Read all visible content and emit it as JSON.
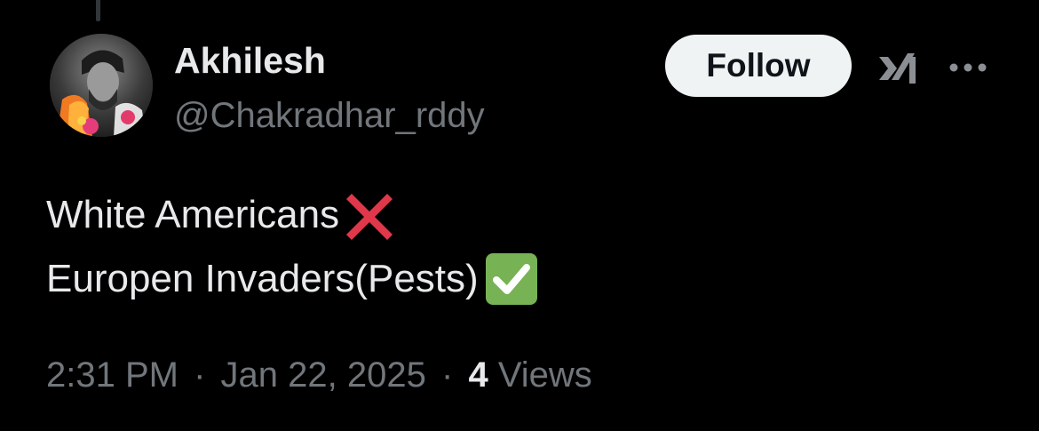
{
  "user": {
    "name": "Akhilesh",
    "handle": "@Chakradhar_rddy"
  },
  "follow_label": "Follow",
  "tweet": {
    "line1": "White Americans",
    "line2": "Europen Invaders(Pests)"
  },
  "meta": {
    "time": "2:31 PM",
    "separator": "·",
    "date": "Jan 22, 2025",
    "views_count": "4",
    "views_label": "Views"
  },
  "icons": {
    "grok": "grok-icon",
    "more": "more-icon",
    "cross": "cross-mark-emoji",
    "check": "check-mark-emoji"
  },
  "colors": {
    "background": "#000000",
    "primary_text": "#e7e9ea",
    "secondary_text": "#71767b",
    "follow_bg": "#eff3f4",
    "cross_red": "#e0384a",
    "check_green": "#77b255"
  }
}
